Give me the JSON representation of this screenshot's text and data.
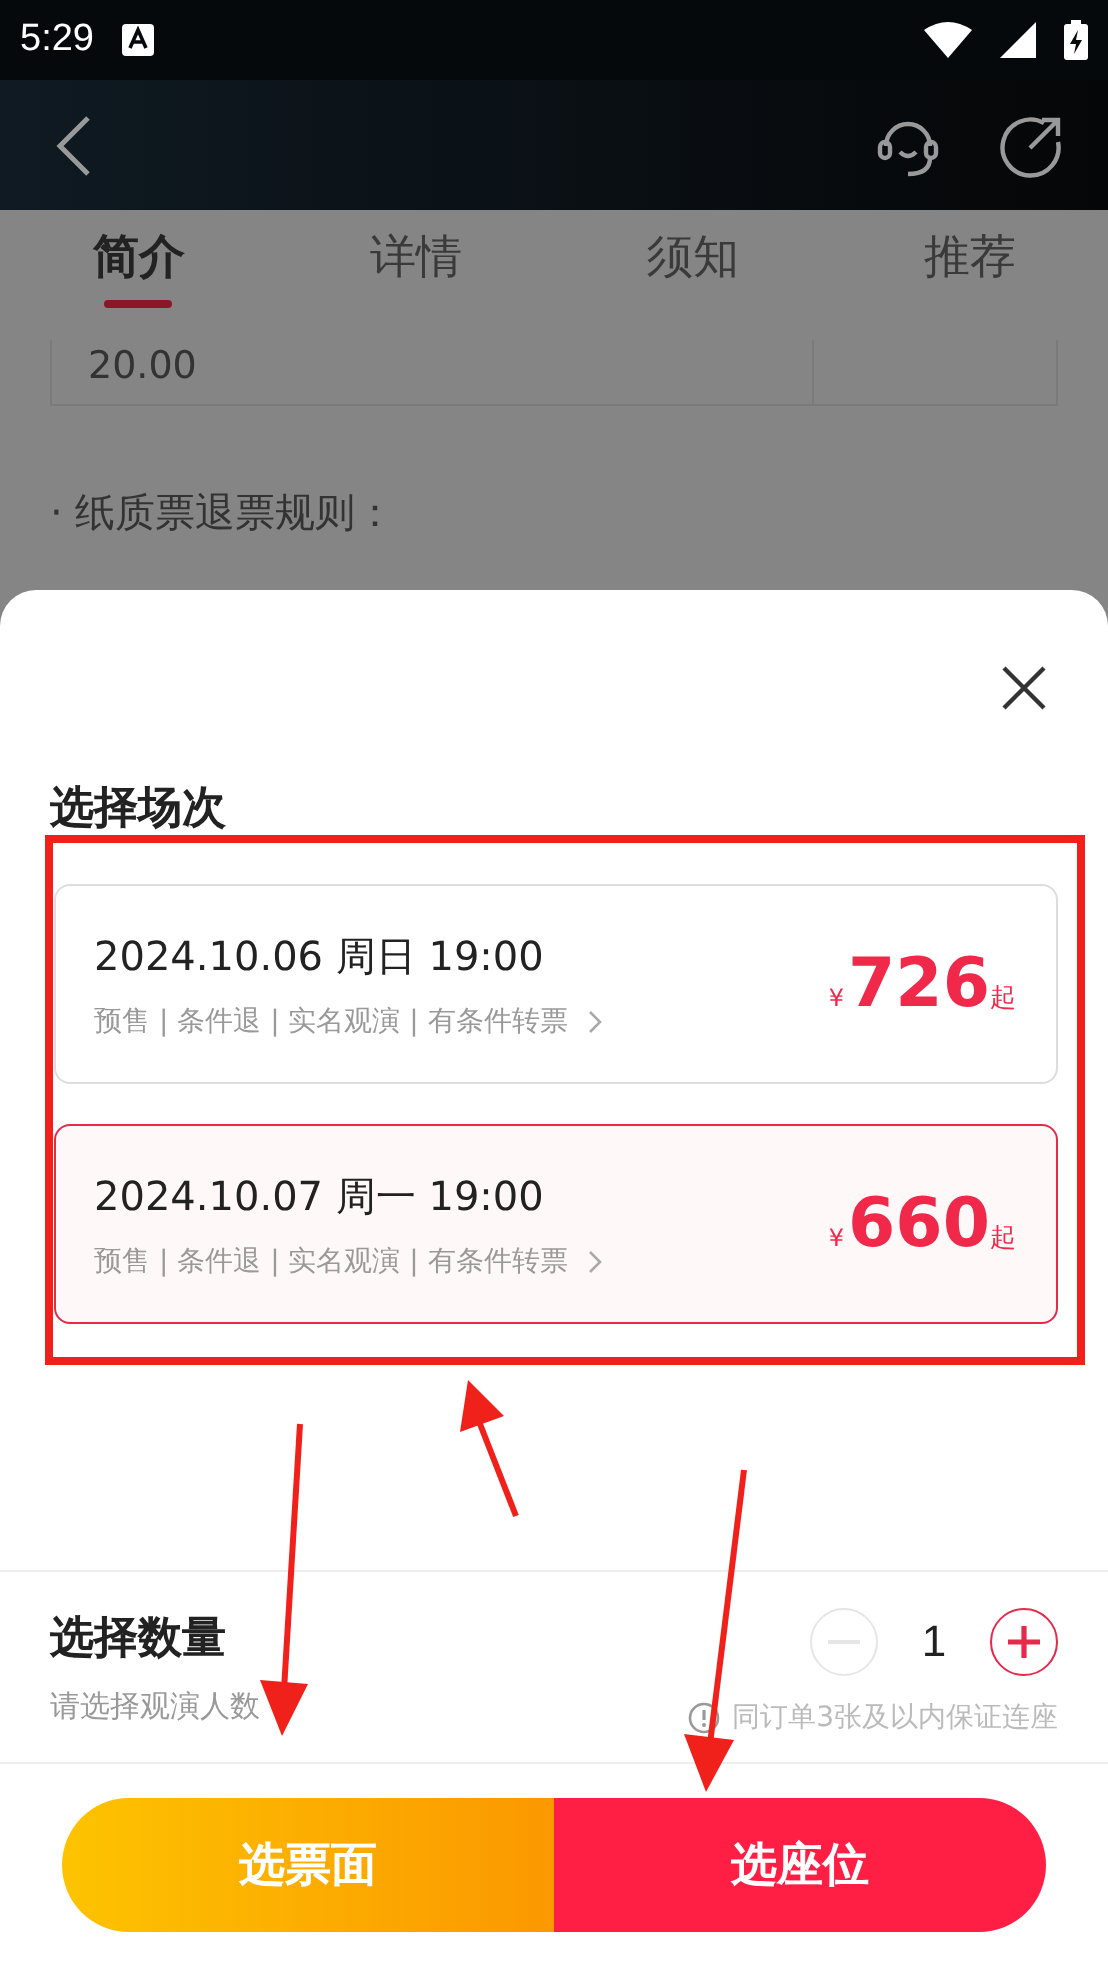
{
  "status_bar": {
    "time": "5:29"
  },
  "tabs": [
    {
      "label": "简介",
      "selected": true
    },
    {
      "label": "详情",
      "selected": false
    },
    {
      "label": "须知",
      "selected": false
    },
    {
      "label": "推荐",
      "selected": false
    }
  ],
  "background": {
    "cell_value": "20.00",
    "rule_heading": "· 纸质票退票规则："
  },
  "sheet": {
    "title": "选择场次",
    "sessions": [
      {
        "datetime": "2024.10.06 周日 19:00",
        "tags": "预售 | 条件退 | 实名观演 | 有条件转票",
        "currency": "¥",
        "price": "726",
        "suffix": "起",
        "selected": false
      },
      {
        "datetime": "2024.10.07 周一 19:00",
        "tags": "预售 | 条件退 | 实名观演 | 有条件转票",
        "currency": "¥",
        "price": "660",
        "suffix": "起",
        "selected": true
      }
    ],
    "quantity": {
      "title": "选择数量",
      "subtitle": "请选择观演人数",
      "value": "1",
      "minus_disabled": true,
      "hint": "同订单3张及以内保证连座"
    },
    "buttons": [
      {
        "label": "选票面",
        "kind": "ticket"
      },
      {
        "label": "选座位",
        "kind": "seat"
      }
    ]
  }
}
